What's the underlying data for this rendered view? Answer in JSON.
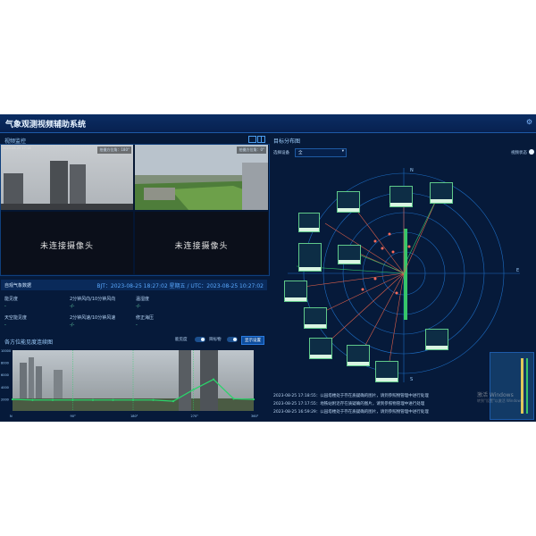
{
  "app": {
    "title": "气象观测视频辅助系统"
  },
  "video_panel": {
    "title": "视频监控",
    "feeds": [
      {
        "label": "拍摄方位角：180°",
        "timestamp": "2023-08-25 17:18"
      },
      {
        "label": "拍摄方位角：0°"
      },
      {
        "placeholder": "未连接摄像头"
      },
      {
        "placeholder": "未连接摄像头"
      }
    ]
  },
  "weather": {
    "title": "自观气象数据",
    "time": "BJT：2023-08-25 18:27:02 星期五 / UTC：2023-08-25 10:27:02",
    "items": [
      {
        "label": "能见度",
        "value": "-"
      },
      {
        "label": "2分钟风向/10分钟风向",
        "value": "-/-"
      },
      {
        "label": "温湿度",
        "value": "-/-"
      },
      {
        "label": "天空能见度",
        "value": "-"
      },
      {
        "label": "2分钟风速/10分钟风速",
        "value": "-/-"
      },
      {
        "label": "修正海压",
        "value": "-"
      }
    ]
  },
  "panorama": {
    "title": "各方位能见度连续图",
    "toggle1": "能见度",
    "toggle2": "目标物",
    "button": "显示设置",
    "y_ticks": [
      "10000",
      "8000",
      "6000",
      "4000",
      "2000"
    ],
    "x_ticks": [
      "N",
      "90°",
      "180°",
      "270°",
      "360°"
    ]
  },
  "target_panel": {
    "title": "目标分布图",
    "select_label": "选择设备",
    "select_value": "全",
    "status_label": "视频状态",
    "compass": {
      "n": "N",
      "e": "E",
      "s": "S",
      "w": "W"
    }
  },
  "chart_data": {
    "type": "line",
    "title": "各方位能见度连续图",
    "xlabel": "",
    "ylabel": "",
    "x": [
      0,
      30,
      60,
      90,
      120,
      150,
      180,
      210,
      240,
      270,
      300,
      330,
      360
    ],
    "series": [
      {
        "values": [
          1900,
          1800,
          1800,
          1800,
          1800,
          1800,
          1800,
          1800,
          1600,
          3500,
          5200,
          2000,
          1900
        ]
      }
    ],
    "ylim": [
      0,
      10000
    ],
    "grid": true
  },
  "logs": [
    "2023-08-25 17:18:55：公园塔楼处于存在质疑确的图片，请到参照物管理中进行处理",
    "2023-08-25 17:17:55：地铁站附近存在质疑确的图片，请到参照物管理中进行处理",
    "2023-08-25 16:59:29：公园塔楼处于存在质疑确的图片，请到参照物管理中进行处理"
  ],
  "windows_watermark": {
    "line1": "激活 Windows",
    "line2": "转到\"设置\"以激活 Windows。"
  }
}
